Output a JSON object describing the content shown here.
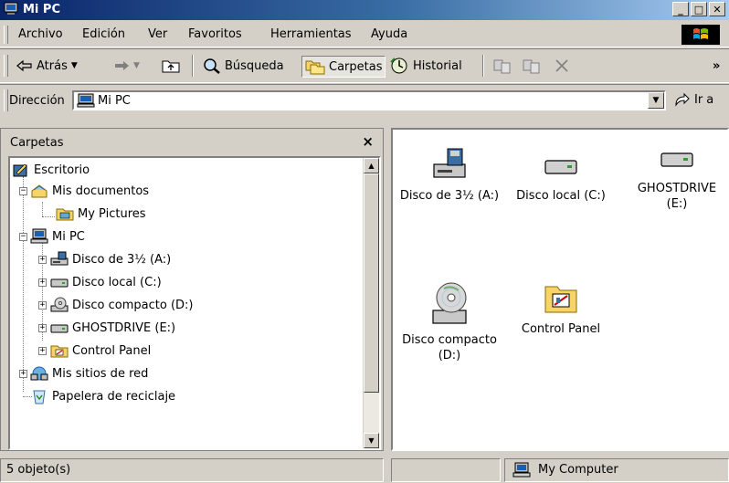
{
  "window": {
    "title": "Mi PC",
    "controls": [
      "_",
      "□",
      "✕"
    ]
  },
  "menubar": {
    "items": [
      "Archivo",
      "Edición",
      "Ver",
      "Favoritos",
      "Herramientas",
      "Ayuda"
    ]
  },
  "toolbar": {
    "back_label": "Atrás",
    "search_label": "Búsqueda",
    "folders_label": "Carpetas",
    "history_label": "Historial",
    "more": "»"
  },
  "address": {
    "label": "Dirección",
    "value": "Mi PC",
    "go_label": "Ir a"
  },
  "folders_pane": {
    "title": "Carpetas",
    "close": "×",
    "tree": [
      {
        "label": "Escritorio"
      },
      {
        "label": "Mis documentos"
      },
      {
        "label": "My Pictures"
      },
      {
        "label": "Mi PC"
      },
      {
        "label": "Disco de 3½ (A:)"
      },
      {
        "label": "Disco local (C:)"
      },
      {
        "label": "Disco compacto (D:)"
      },
      {
        "label": "GHOSTDRIVE (E:)"
      },
      {
        "label": "Control Panel"
      },
      {
        "label": "Mis sitios de red"
      },
      {
        "label": "Papelera de reciclaje"
      }
    ]
  },
  "content_items": [
    {
      "label": "Disco de 3½ (A:)"
    },
    {
      "label": "Disco local (C:)"
    },
    {
      "label": "GHOSTDRIVE (E:)"
    },
    {
      "label": "Disco compacto (D:)"
    },
    {
      "label": "Control Panel"
    }
  ],
  "status": {
    "count": "5 objeto(s)",
    "zone": "My Computer"
  }
}
